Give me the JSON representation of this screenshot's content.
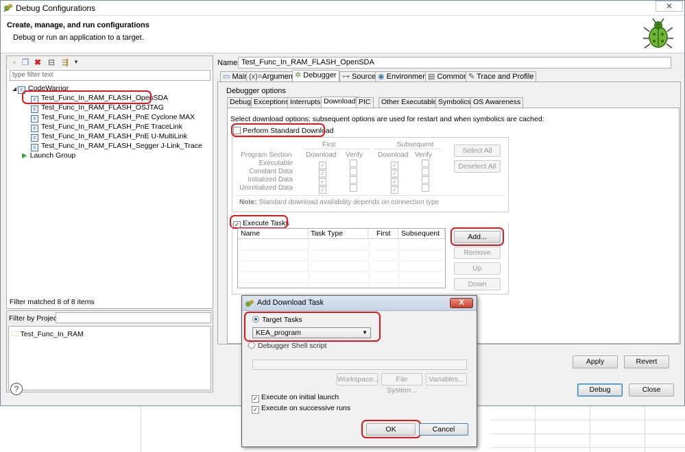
{
  "window": {
    "title": "Debug Configurations",
    "close_glyph": "✕",
    "header_title": "Create, manage, and run configurations",
    "header_subtitle": "Debug or run an application to a target."
  },
  "left": {
    "filter_placeholder": "type filter text",
    "tree_root": "CodeWarrior",
    "tree_items": [
      "Test_Func_In_RAM_FLASH_OpenSDA",
      "Test_Func_In_RAM_FLASH_OSJTAG",
      "Test_Func_In_RAM_FLASH_PnE Cyclone MAX",
      "Test_Func_In_RAM_FLASH_PnE TraceLink",
      "Test_Func_In_RAM_FLASH_PnE U-MultiLink",
      "Test_Func_In_RAM_FLASH_Segger J-Link_Trace"
    ],
    "launch_group": "Launch Group",
    "filter_status": "Filter matched 8 of 8 items",
    "filter_by_project_label": "Filter by Project:",
    "project_item": "Test_Func_In_RAM"
  },
  "config": {
    "name_label": "Name:",
    "name_value": "Test_Func_In_RAM_FLASH_OpenSDA",
    "tabs": [
      "Main",
      "Arguments",
      "Debugger",
      "Source",
      "Environment",
      "Common",
      "Trace and Profile"
    ],
    "debugger_options_label": "Debugger options",
    "subtabs": [
      "Debug",
      "Exceptions",
      "Interrupts",
      "Download",
      "PIC",
      "Other Executables",
      "Symbolics",
      "OS Awareness"
    ],
    "download_desc": "Select download options; subsequent options are used for restart and when symbolics are cached:",
    "perform_std_download": "Perform Standard Download",
    "perform_std_download_checked": false,
    "program_table": {
      "group_first": "First",
      "group_subsequent": "Subsequent",
      "col_section": "Program Section",
      "col_download": "Download",
      "col_verify": "Verify",
      "col_download2": "Download",
      "col_verify2": "Verify",
      "rows": [
        "Executable",
        "Constant Data",
        "Initialized Data",
        "Uninitialized Data"
      ]
    },
    "select_all": "Select All",
    "deselect_all": "Deselect All",
    "note_label": "Note:",
    "note_text": "Standard download availability depends on connection type",
    "execute_tasks": "Execute Tasks",
    "execute_tasks_checked": true,
    "task_columns": [
      "Name",
      "Task Type",
      "First",
      "Subsequent"
    ],
    "add_button": "Add...",
    "remove_button": "Remove",
    "up_button": "Up",
    "down_button": "Down",
    "apply_button": "Apply",
    "revert_button": "Revert",
    "debug_button": "Debug",
    "close_button": "Close"
  },
  "dialog": {
    "title": "Add Download Task",
    "close_glyph": "X",
    "target_tasks": "Target Tasks",
    "target_tasks_selected": true,
    "combo_value": "KEA_program",
    "shell_script": "Debugger Shell script",
    "workspace_button": "Workspace...",
    "file_system_button": "File System...",
    "variables_button": "Variables...",
    "execute_initial": "Execute on initial launch",
    "execute_successive": "Execute on successive runs",
    "ok_button": "OK",
    "cancel_button": "Cancel"
  },
  "colors": {
    "highlight": "#e0161d",
    "window_bg": "#f0f0f0",
    "launch_group_icon": "#3aa63a"
  },
  "icons": {
    "app": "bug-gear-icon",
    "header": "green-bug-icon",
    "new": "new-config-icon",
    "duplicate": "duplicate-icon",
    "delete": "delete-icon",
    "collapse": "collapse-all-icon",
    "filter": "filter-icon",
    "help": "help-icon"
  }
}
